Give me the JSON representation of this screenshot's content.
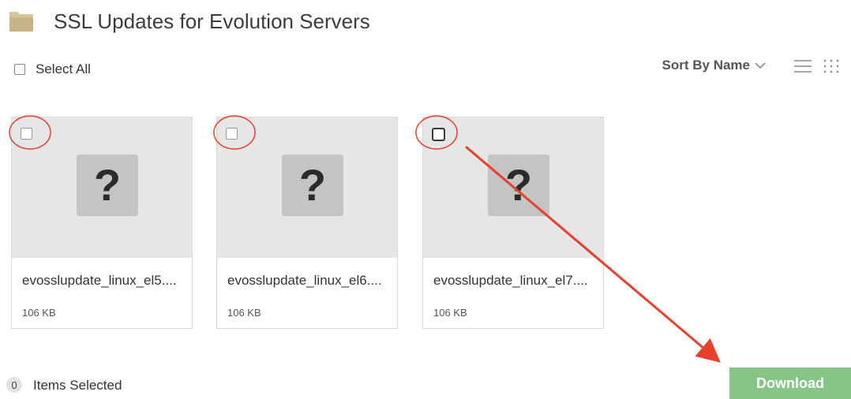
{
  "header": {
    "title": "SSL Updates for Evolution Servers",
    "icon": "folder-icon"
  },
  "toolbar": {
    "select_all_label": "Select All",
    "sort_label": "Sort By Name"
  },
  "files": [
    {
      "name": "evosslupdate_linux_el5....",
      "size": "106 KB"
    },
    {
      "name": "evosslupdate_linux_el6....",
      "size": "106 KB"
    },
    {
      "name": "evosslupdate_linux_el7....",
      "size": "106 KB"
    }
  ],
  "placeholder_glyph": "?",
  "footer": {
    "selected_count": "0",
    "selected_label": "Items Selected",
    "download_label": "Download"
  },
  "colors": {
    "download_button": "#86c586",
    "annotation": "#e8402a",
    "folder": "#c9b389"
  }
}
